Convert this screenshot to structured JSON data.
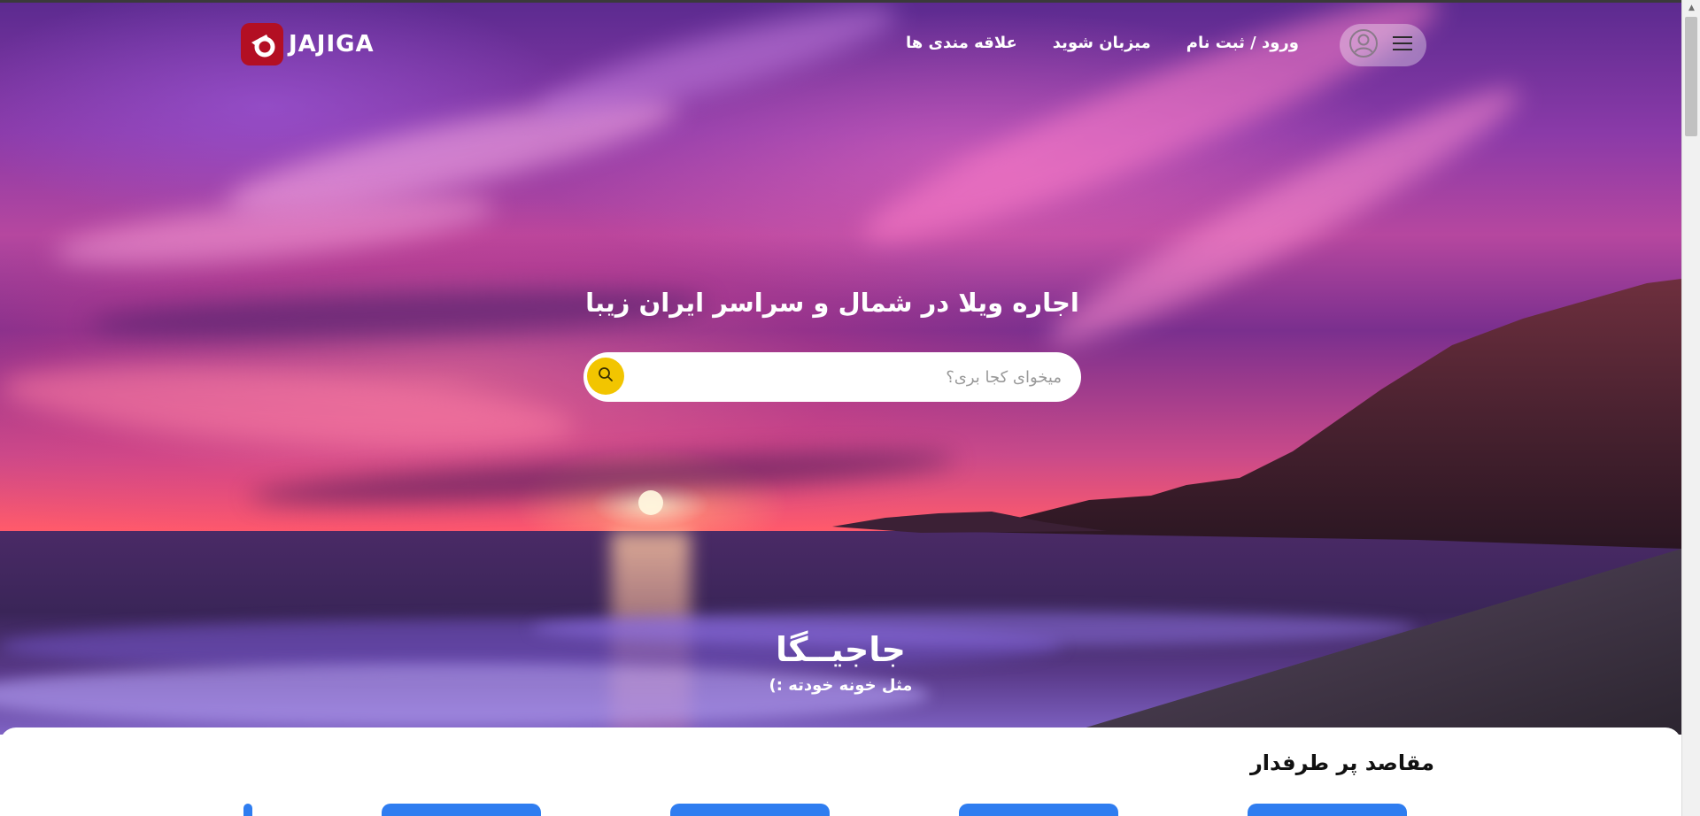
{
  "header": {
    "logo_text": "JAJIGA",
    "nav": {
      "login": "ورود / ثبت نام",
      "host": "میزبان شوید",
      "favorites": "علاقه مندی ها"
    }
  },
  "hero": {
    "title": "اجاره ویلا در شمال و سراسر ایران زیبا",
    "search": {
      "placeholder": "میخوای کجا بری؟",
      "value": ""
    },
    "brand_fa": "جاجیــگا",
    "tagline": "مثل خونه خودته :)"
  },
  "destinations": {
    "title": "مقاصد پر طرفدار"
  },
  "colors": {
    "accent_yellow": "#f2c500",
    "logo_red": "#b30f23",
    "card_blue": "#2f7df0"
  },
  "icons": {
    "menu": "hamburger-menu-icon",
    "user": "user-avatar-icon",
    "search": "search-icon"
  }
}
